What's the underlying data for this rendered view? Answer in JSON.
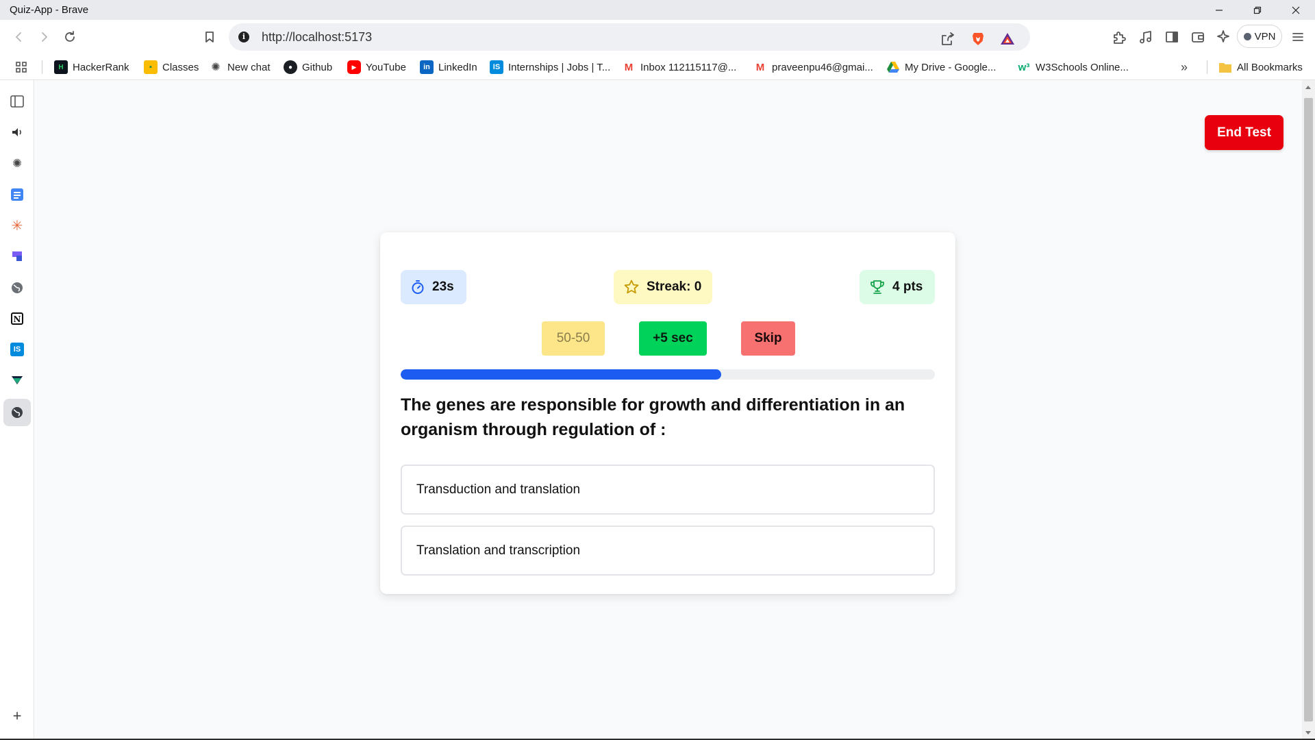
{
  "window": {
    "title": "Quiz-App - Brave"
  },
  "toolbar": {
    "url": "http://localhost:5173",
    "vpn_label": "VPN"
  },
  "bookmarks": {
    "items": [
      {
        "label": "HackerRank",
        "icon": "hackerrank-icon"
      },
      {
        "label": "Classes",
        "icon": "classes-icon"
      },
      {
        "label": "New chat",
        "icon": "chatgpt-icon"
      },
      {
        "label": "Github",
        "icon": "github-icon"
      },
      {
        "label": "YouTube",
        "icon": "youtube-icon"
      },
      {
        "label": "LinkedIn",
        "icon": "linkedin-icon"
      },
      {
        "label": "Internships | Jobs | T...",
        "icon": "internshala-icon"
      },
      {
        "label": "Inbox 112115117@...",
        "icon": "gmail-icon"
      },
      {
        "label": "praveenpu46@gmai...",
        "icon": "gmail-icon"
      },
      {
        "label": "My Drive - Google...",
        "icon": "google-drive-icon"
      },
      {
        "label": "W3Schools Online...",
        "icon": "w3schools-icon"
      }
    ],
    "all_bookmarks": "All Bookmarks"
  },
  "quiz": {
    "end_test": "End Test",
    "timer": "23s",
    "streak": "Streak: 0",
    "points": "4 pts",
    "lifelines": {
      "fifty": "50-50",
      "plus_time": "+5 sec",
      "skip": "Skip"
    },
    "progress": 0.6,
    "question": "The genes are responsible for growth and differentiation in an organism through regulation of :",
    "options": [
      "Transduction and translation",
      "Translation and transcription"
    ]
  },
  "colors": {
    "end_test": "#e8000e",
    "progress": "#1d5cf0",
    "timer_bg": "#dbeafe",
    "streak_bg": "#fef9c3",
    "points_bg": "#dcfce7",
    "fifty_bg": "#fde68a",
    "plus_bg": "#00d25a",
    "skip_bg": "#f87171"
  }
}
